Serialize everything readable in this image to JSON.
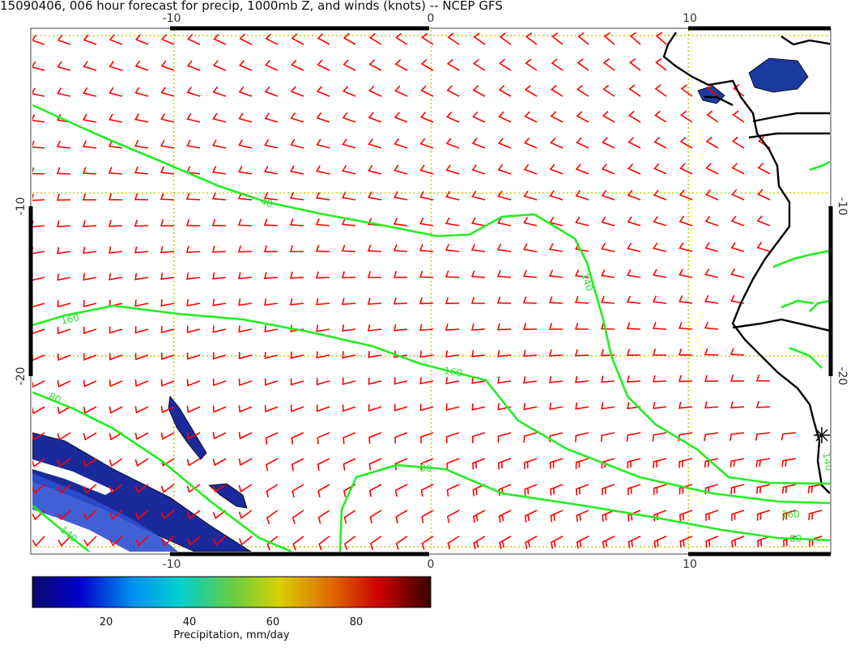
{
  "title": "15090406, 006 hour forecast for precip, 1000mb Z, and winds (knots) -- NCEP GFS",
  "map": {
    "lon_ticks": [
      "-10",
      "0",
      "10"
    ],
    "lat_ticks": [
      "-10",
      "-20"
    ],
    "contour_labels": [
      "40",
      "140",
      "160",
      "160",
      "80",
      "80",
      "140",
      "80",
      "140",
      "160"
    ]
  },
  "colorbar": {
    "ticks": [
      "20",
      "40",
      "60",
      "80"
    ],
    "label": "Precipitation, mm/day"
  },
  "colors": {
    "contour": "#22ee22",
    "wind_barb": "#ff0000",
    "coastline": "#000000",
    "grid": "#cccc00",
    "precip_low": "#1a2a8a"
  },
  "chart_data": {
    "type": "heatmap",
    "title": "15090406, 006 hour forecast for precip, 1000mb Z, and winds (knots) -- NCEP GFS",
    "xlim": [
      -15.5,
      15.5
    ],
    "ylim": [
      -32,
      0
    ],
    "x_ticks": [
      -10,
      0,
      10
    ],
    "y_ticks": [
      -10,
      -20
    ],
    "colorbar_range": [
      0,
      95
    ],
    "colorbar_ticks": [
      20,
      40,
      60,
      80
    ],
    "colorbar_label": "Precipitation, mm/day",
    "height_contours": [
      {
        "label": "40",
        "approx_points": [
          [
            -15.3,
            -4.2
          ],
          [
            -10,
            -6.2
          ],
          [
            -6,
            -9.2
          ],
          [
            -3,
            -10.3
          ],
          [
            0.3,
            -11.8
          ],
          [
            3.5,
            -10.1
          ],
          [
            5.8,
            -10.8
          ],
          [
            6.5,
            -13.5
          ],
          [
            7,
            -15.5
          ],
          [
            7.7,
            -19
          ],
          [
            8.7,
            -21
          ],
          [
            11,
            -23
          ],
          [
            13,
            -24.5
          ],
          [
            15.4,
            -24.6
          ]
        ]
      },
      {
        "label": "160",
        "approx_points": [
          [
            -15.3,
            -17.5
          ],
          [
            -12.5,
            -16.2
          ],
          [
            -8,
            -16.9
          ],
          [
            -5.3,
            -17.5
          ],
          [
            -2.5,
            -18.9
          ],
          [
            0.5,
            -19.6
          ],
          [
            3,
            -20.5
          ],
          [
            5,
            -23.5
          ],
          [
            8,
            -25.5
          ],
          [
            11,
            -26.6
          ],
          [
            13.5,
            -27
          ],
          [
            15.4,
            -27.2
          ]
        ]
      },
      {
        "label": "80",
        "approx_points": [
          [
            -15.3,
            -21.5
          ],
          [
            -12.5,
            -23
          ],
          [
            -9,
            -25.5
          ],
          [
            -6,
            -28.5
          ],
          [
            -4,
            -31.5
          ]
        ]
      },
      {
        "label": "80",
        "approx_points": [
          [
            -3.5,
            -31.5
          ],
          [
            -3.3,
            -28.5
          ],
          [
            -1.5,
            -26.5
          ],
          [
            1,
            -26.6
          ],
          [
            3,
            -27.5
          ],
          [
            6,
            -28.5
          ],
          [
            10,
            -29.5
          ],
          [
            13,
            -30.8
          ],
          [
            15.4,
            -31
          ]
        ]
      },
      {
        "label": "140",
        "approx_points": [
          [
            -15.3,
            -28.8
          ],
          [
            -13,
            -30.5
          ],
          [
            -12,
            -31.5
          ]
        ]
      }
    ],
    "precip_regions": [
      {
        "intensity_mm_day": "5-25",
        "approx_lon_range": [
          -15.5,
          -7.5
        ],
        "approx_lat_range": [
          -32,
          -24.5
        ]
      },
      {
        "intensity_mm_day": "5-15",
        "approx_lon_range": [
          -10,
          -8.5
        ],
        "approx_lat_range": [
          -26,
          -22
        ]
      },
      {
        "intensity_mm_day": "5-15",
        "approx_lon_range": [
          -8.5,
          -7
        ],
        "approx_lat_range": [
          -28.5,
          -27
        ]
      },
      {
        "intensity_mm_day": "5-30",
        "approx_lon_range": [
          10,
          15
        ],
        "approx_lat_range": [
          -4.5,
          -1.5
        ]
      }
    ],
    "wind_barbs": "regular grid of red wind barbs (knots) over the whole domain"
  }
}
